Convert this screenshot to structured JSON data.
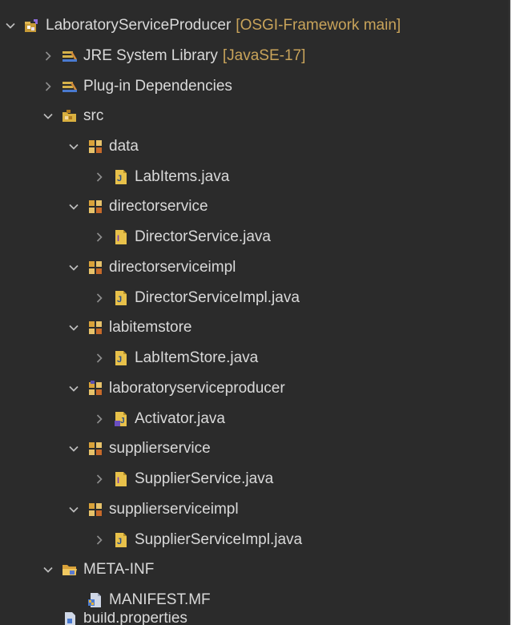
{
  "project": {
    "name": "LaboratoryServiceProducer",
    "decoration": "[OSGI-Framework main]"
  },
  "jre": {
    "name": "JRE System Library",
    "decoration": "[JavaSE-17]"
  },
  "plugin_deps": {
    "name": "Plug-in Dependencies"
  },
  "src": {
    "name": "src"
  },
  "packages": [
    {
      "name": "data",
      "file": "LabItems.java"
    },
    {
      "name": "directorservice",
      "file": "DirectorService.java"
    },
    {
      "name": "directorserviceimpl",
      "file": "DirectorServiceImpl.java"
    },
    {
      "name": "labitemstore",
      "file": "LabItemStore.java"
    },
    {
      "name": "laboratoryserviceproducer",
      "file": "Activator.java"
    },
    {
      "name": "supplierservice",
      "file": "SupplierService.java"
    },
    {
      "name": "supplierserviceimpl",
      "file": "SupplierServiceImpl.java"
    }
  ],
  "meta_inf": {
    "name": "META-INF",
    "manifest": "MANIFEST.MF"
  },
  "build_properties": {
    "name": "build.properties"
  },
  "colors": {
    "background": "#2b2b2b",
    "text": "#d9d9d9",
    "decoration": "#c8a35a",
    "chevron": "#a9a9a9"
  },
  "icons": {
    "project": "plugin-project-icon",
    "library": "library-icon",
    "source_folder": "source-folder-icon",
    "package": "package-icon",
    "class_file": "java-class-file-icon",
    "interface_file": "java-interface-file-icon",
    "folder": "folder-icon",
    "manifest": "manifest-file-icon",
    "properties": "properties-file-icon"
  }
}
